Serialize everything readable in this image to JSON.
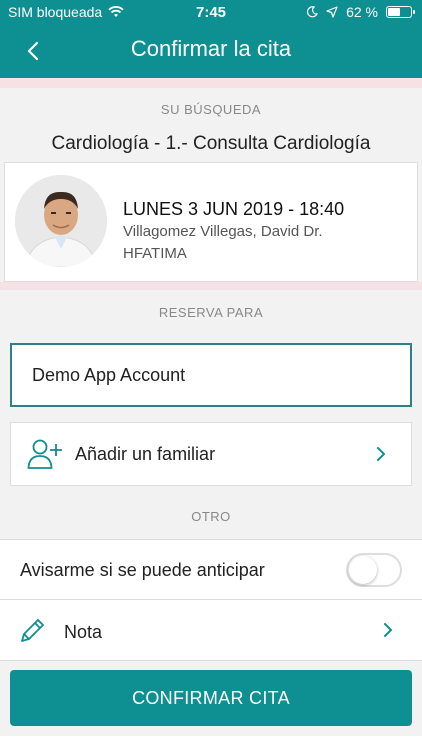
{
  "status_bar": {
    "carrier": "SIM bloqueada",
    "time": "7:45",
    "battery_percent": "62 %",
    "battery_level": 0.62
  },
  "nav": {
    "title": "Confirmar la cita"
  },
  "search": {
    "section_label": "SU BÚSQUEDA",
    "specialty": "Cardiología - 1.- Consulta Cardiología"
  },
  "appointment": {
    "date_time": "LUNES 3 JUN 2019 - 18:40",
    "doctor": "Villagomez Villegas, David Dr.",
    "center": "HFATIMA"
  },
  "booking": {
    "section_label": "RESERVA PARA",
    "selected_account": "Demo App Account",
    "add_family_label": "Añadir un familiar"
  },
  "other": {
    "section_label": "OTRO",
    "notify_label": "Avisarme si se puede anticipar",
    "notify_enabled": false,
    "note_label": "Nota"
  },
  "confirm_button": "CONFIRMAR CITA",
  "colors": {
    "primary": "#0e8f92",
    "accent_border": "#2f7f8a",
    "separator": "#f6e1e6"
  }
}
